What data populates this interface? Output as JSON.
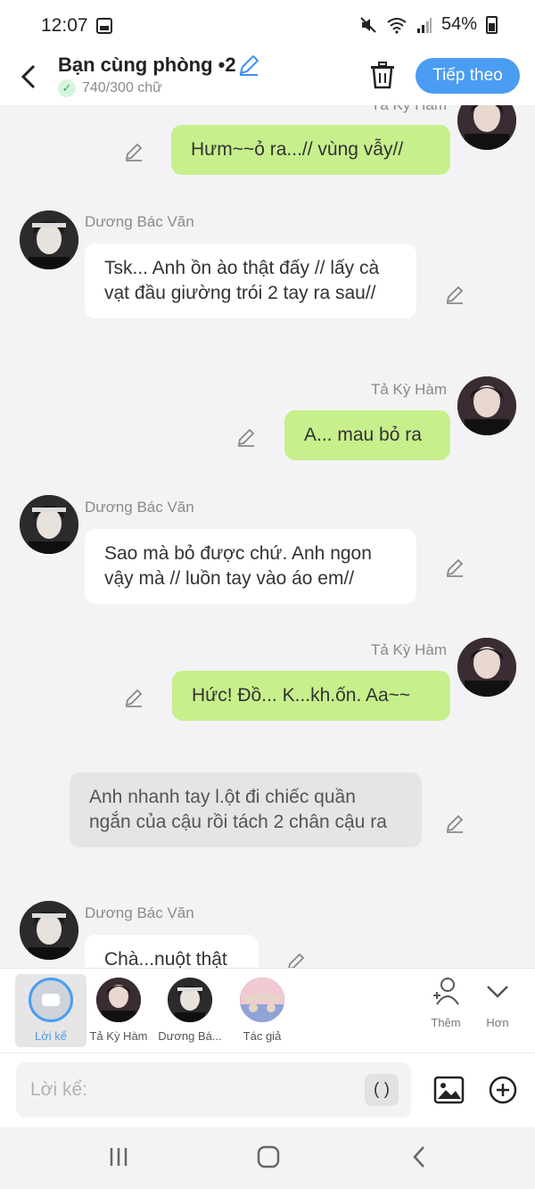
{
  "status_bar": {
    "time": "12:07",
    "battery": "54%"
  },
  "header": {
    "title": "Bạn cùng phòng •2",
    "word_count": "740/300 chữ",
    "next_button": "Tiếp theo"
  },
  "messages": [
    {
      "type": "user",
      "name": "Tả Kỳ Hàm",
      "text": "Hưm~~ỏ ra...// vùng vẫy//"
    },
    {
      "type": "char",
      "name": "Dương Bác Văn",
      "text": "Tsk... Anh ồn ào thật đấy // lấy cà vạt đầu giường trói 2 tay ra sau//"
    },
    {
      "type": "user",
      "name": "Tả Kỳ Hàm",
      "text": "A... mau bỏ ra"
    },
    {
      "type": "char",
      "name": "Dương Bác Văn",
      "text": "Sao mà bỏ được chứ. Anh ngon vậy mà // luồn tay vào áo em//"
    },
    {
      "type": "user",
      "name": "Tả Kỳ Hàm",
      "text": "Hức! Đồ... K...kh.ốn. Aa~~"
    },
    {
      "type": "narration",
      "text": "Anh nhanh tay l.ột đi chiếc quần ngắn của cậu rồi tách 2 chân cậu ra"
    },
    {
      "type": "char",
      "name": "Dương Bác Văn",
      "text": "Chà...nuột thật"
    }
  ],
  "characters": [
    {
      "label": "Lời kể"
    },
    {
      "label": "Tả Kỳ Hàm"
    },
    {
      "label": "Dương Bá..."
    },
    {
      "label": "Tác giả"
    }
  ],
  "side_buttons": {
    "add": "Thêm",
    "more": "Hơn"
  },
  "input": {
    "placeholder": "Lời kể:",
    "paren": "( )"
  },
  "colors": {
    "accent": "#4a9df2",
    "user_bubble": "#c7ef8c",
    "char_bubble": "#ffffff",
    "narration_bubble": "#e5e5e7"
  }
}
